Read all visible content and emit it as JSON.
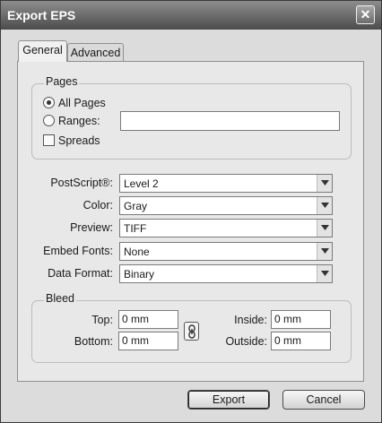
{
  "dialog": {
    "title": "Export EPS",
    "close_glyph": "✕"
  },
  "tabs": [
    {
      "label": "General",
      "active": true
    },
    {
      "label": "Advanced",
      "active": false
    }
  ],
  "pages": {
    "group_label": "Pages",
    "all_pages": {
      "label": "All Pages",
      "checked": true
    },
    "ranges": {
      "label": "Ranges:",
      "checked": false,
      "value": ""
    },
    "spreads": {
      "label": "Spreads",
      "checked": false
    }
  },
  "settings": [
    {
      "label": "PostScript®:",
      "value": "Level 2"
    },
    {
      "label": "Color:",
      "value": "Gray"
    },
    {
      "label": "Preview:",
      "value": "TIFF"
    },
    {
      "label": "Embed Fonts:",
      "value": "None"
    },
    {
      "label": "Data Format:",
      "value": "Binary"
    }
  ],
  "bleed": {
    "group_label": "Bleed",
    "top": {
      "label": "Top:",
      "value": "0 mm"
    },
    "bottom": {
      "label": "Bottom:",
      "value": "0 mm"
    },
    "inside": {
      "label": "Inside:",
      "value": "0 mm"
    },
    "outside": {
      "label": "Outside:",
      "value": "0 mm"
    },
    "link_icon": "chain-link-icon"
  },
  "buttons": {
    "export": "Export",
    "cancel": "Cancel"
  }
}
